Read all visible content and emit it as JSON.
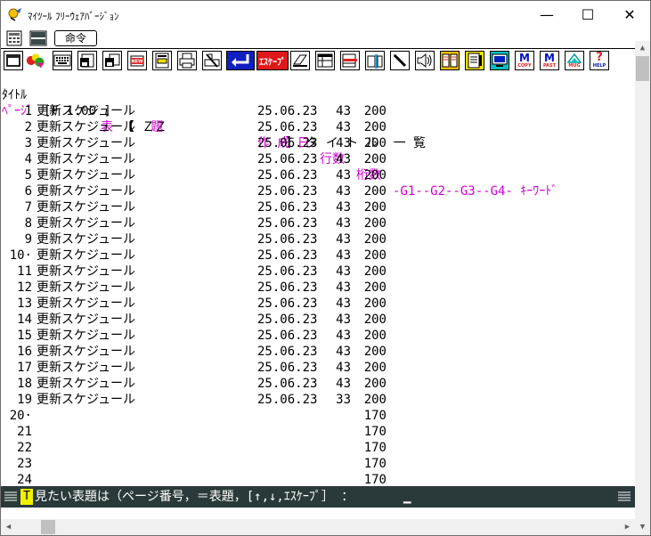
{
  "window": {
    "title": "ﾏｲﾂｰﾙ ﾌﾘｰｳｪｱﾊﾞｰｼﾞｮﾝ",
    "minimize_glyph": "—",
    "maximize_glyph": "☐",
    "close_glyph": "✕"
  },
  "menubar": {
    "command_label": "命令"
  },
  "toolbar": {
    "escape_label": "ｴｽｹｰﾌﾟ",
    "copy_label": "M",
    "copy_sub": "COPY",
    "paste_label": "M",
    "paste_sub": "PAST",
    "mug_sub": "MUG",
    "help_label": "?",
    "help_sub": "HELP",
    "new_label": "NEW"
  },
  "header": {
    "line1_prefix": "ﾀｲﾄﾙ",
    "file_version": "[F 1.00 ]",
    "name_field": "【 ＺＺ                ",
    "name_field_end": "】 タ イ ト ル  一 覧",
    "col_page": "ﾍﾟｰｼﾞ",
    "col_title": "表     題",
    "col_date": "作 成 日",
    "col_lines": "行数",
    "col_width": "桁数",
    "col_groups": "-G1--G2--G3--G4- ｷｰﾜｰﾄﾞ"
  },
  "rows": [
    {
      "page": "1",
      "title": "更新スケジュール",
      "date": "25.06.23",
      "lines": "43",
      "width": "200"
    },
    {
      "page": "2",
      "title": "更新スケジュール",
      "date": "25.06.23",
      "lines": "43",
      "width": "200"
    },
    {
      "page": "3",
      "title": "更新スケジュール",
      "date": "25.06.23",
      "lines": "43",
      "width": "200"
    },
    {
      "page": "4",
      "title": "更新スケジュール",
      "date": "25.06.23",
      "lines": "43",
      "width": "200"
    },
    {
      "page": "5",
      "title": "更新スケジュール",
      "date": "25.06.23",
      "lines": "43",
      "width": "200"
    },
    {
      "page": "6",
      "title": "更新スケジュール",
      "date": "25.06.23",
      "lines": "43",
      "width": "200"
    },
    {
      "page": "7",
      "title": "更新スケジュール",
      "date": "25.06.23",
      "lines": "43",
      "width": "200"
    },
    {
      "page": "8",
      "title": "更新スケジュール",
      "date": "25.06.23",
      "lines": "43",
      "width": "200"
    },
    {
      "page": "9",
      "title": "更新スケジュール",
      "date": "25.06.23",
      "lines": "43",
      "width": "200"
    },
    {
      "page": "10·",
      "title": "更新スケジュール",
      "date": "25.06.23",
      "lines": "43",
      "width": "200"
    },
    {
      "page": "11",
      "title": "更新スケジュール",
      "date": "25.06.23",
      "lines": "43",
      "width": "200"
    },
    {
      "page": "12",
      "title": "更新スケジュール",
      "date": "25.06.23",
      "lines": "43",
      "width": "200"
    },
    {
      "page": "13",
      "title": "更新スケジュール",
      "date": "25.06.23",
      "lines": "43",
      "width": "200"
    },
    {
      "page": "14",
      "title": "更新スケジュール",
      "date": "25.06.23",
      "lines": "43",
      "width": "200"
    },
    {
      "page": "15",
      "title": "更新スケジュール",
      "date": "25.06.23",
      "lines": "43",
      "width": "200"
    },
    {
      "page": "16",
      "title": "更新スケジュール",
      "date": "25.06.23",
      "lines": "43",
      "width": "200"
    },
    {
      "page": "17",
      "title": "更新スケジュール",
      "date": "25.06.23",
      "lines": "43",
      "width": "200"
    },
    {
      "page": "18",
      "title": "更新スケジュール",
      "date": "25.06.23",
      "lines": "43",
      "width": "200"
    },
    {
      "page": "19",
      "title": "更新スケジュール",
      "date": "25.06.23",
      "lines": "33",
      "width": "200"
    },
    {
      "page": "20·",
      "title": "",
      "date": "",
      "lines": "",
      "width": "170"
    },
    {
      "page": "21",
      "title": "",
      "date": "",
      "lines": "",
      "width": "170"
    },
    {
      "page": "22",
      "title": "",
      "date": "",
      "lines": "",
      "width": "170"
    },
    {
      "page": "23",
      "title": "",
      "date": "",
      "lines": "",
      "width": "170"
    },
    {
      "page": "24",
      "title": "",
      "date": "",
      "lines": "",
      "width": "170"
    }
  ],
  "status": {
    "key": "T",
    "prompt": "見たい表題は（ページ番号，＝表題，[↑,↓,ｴｽｹｰﾌﾟ］ ：",
    "cursor": "▁"
  },
  "colors": {
    "magenta": "#d000d0",
    "status_bg": "#2a3a3a",
    "escape_bg": "#e01818",
    "enter_bg": "#1020c0"
  }
}
